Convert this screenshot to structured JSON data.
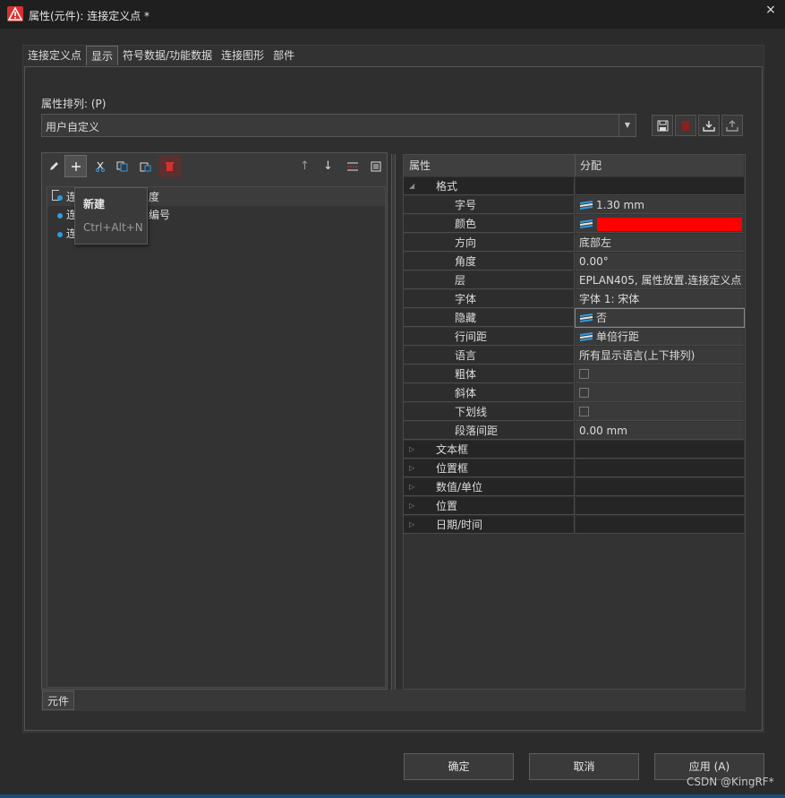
{
  "window": {
    "title": "属性(元件): 连接定义点 *",
    "close_label": "×"
  },
  "tabs": [
    "连接定义点",
    "显示",
    "符号数据/功能数据",
    "连接图形",
    "部件"
  ],
  "active_tab_index": 1,
  "property_arrangement": {
    "label": "属性排列: (P)",
    "selected": "用户自定义"
  },
  "tree": {
    "items": [
      "连",
      "连",
      "连"
    ],
    "header_fragment": "度",
    "second_fragment": "编号"
  },
  "tooltip": {
    "title": "新建",
    "shortcut": "Ctrl+Alt+N"
  },
  "bottom_tab": "元件",
  "grid": {
    "col_property": "属性",
    "col_value": "分配",
    "rows": [
      {
        "type": "category",
        "expander": "◢",
        "label": "格式",
        "value": "",
        "expanded": true
      },
      {
        "type": "prop",
        "label": "字号",
        "value": "1.30 mm",
        "icon": "layer-icon"
      },
      {
        "type": "prop",
        "label": "颜色",
        "value": "",
        "icon": "layer-icon",
        "color": "#ff0000"
      },
      {
        "type": "prop",
        "label": "方向",
        "value": "底部左"
      },
      {
        "type": "prop",
        "label": "角度",
        "value": "0.00°"
      },
      {
        "type": "prop",
        "label": "层",
        "value": "EPLAN405, 属性放置.连接定义点"
      },
      {
        "type": "prop",
        "label": "字体",
        "value": "字体 1: 宋体"
      },
      {
        "type": "prop",
        "label": "隐藏",
        "value": "否",
        "icon": "layer-icon",
        "selected": true
      },
      {
        "type": "prop",
        "label": "行间距",
        "value": "单倍行距",
        "icon": "layer-icon"
      },
      {
        "type": "prop",
        "label": "语言",
        "value": "所有显示语言(上下排列)"
      },
      {
        "type": "prop",
        "label": "粗体",
        "value": "",
        "checkbox": false
      },
      {
        "type": "prop",
        "label": "斜体",
        "value": "",
        "checkbox": false
      },
      {
        "type": "prop",
        "label": "下划线",
        "value": "",
        "checkbox": false
      },
      {
        "type": "prop",
        "label": "段落间距",
        "value": "0.00 mm"
      },
      {
        "type": "category",
        "expander": "▷",
        "label": "文本框",
        "value": ""
      },
      {
        "type": "category",
        "expander": "▷",
        "label": "位置框",
        "value": ""
      },
      {
        "type": "category",
        "expander": "▷",
        "label": "数值/单位",
        "value": ""
      },
      {
        "type": "category",
        "expander": "▷",
        "label": "位置",
        "value": ""
      },
      {
        "type": "category",
        "expander": "▷",
        "label": "日期/时间",
        "value": ""
      }
    ]
  },
  "buttons": {
    "ok": "确定",
    "cancel": "取消",
    "apply": "应用 (A)"
  },
  "watermark": "CSDN @KingRF*",
  "colors": {
    "accent_red": "#d9302f",
    "dot_blue": "#2f9be0"
  }
}
